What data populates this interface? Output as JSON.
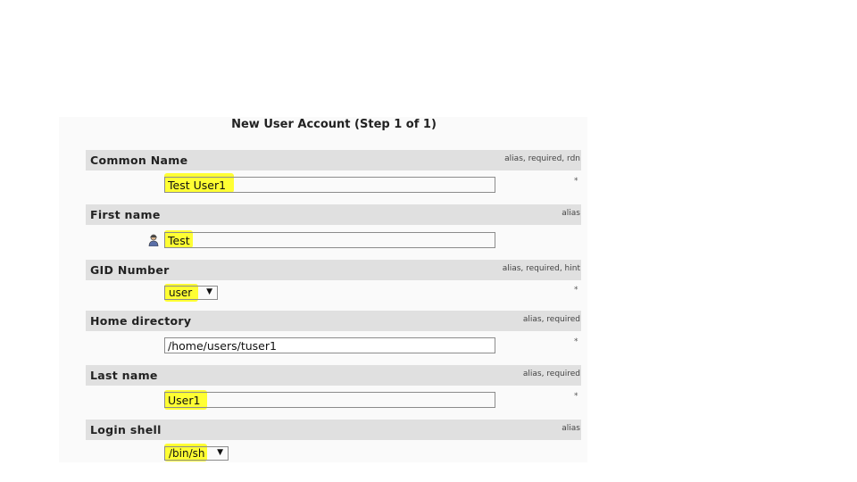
{
  "title": "New User Account (Step 1 of 1)",
  "colors": {
    "highlight": "#ffff33",
    "header_bg": "#e0e0e0"
  },
  "fields": [
    {
      "label": "Common Name",
      "note": "alias, required, rdn",
      "type": "text",
      "value": "Test User1",
      "marker": "*"
    },
    {
      "label": "First name",
      "note": "alias",
      "type": "text",
      "value": "Test",
      "icon": "person-icon"
    },
    {
      "label": "GID Number",
      "note": "alias, required, hint",
      "type": "select",
      "value": "user",
      "marker": "*"
    },
    {
      "label": "Home directory",
      "note": "alias, required",
      "type": "text",
      "value": "/home/users/tuser1",
      "marker": "*"
    },
    {
      "label": "Last name",
      "note": "alias, required",
      "type": "text",
      "value": "User1",
      "marker": "*"
    },
    {
      "label": "Login shell",
      "note": "alias",
      "type": "select",
      "value": "/bin/sh"
    }
  ]
}
